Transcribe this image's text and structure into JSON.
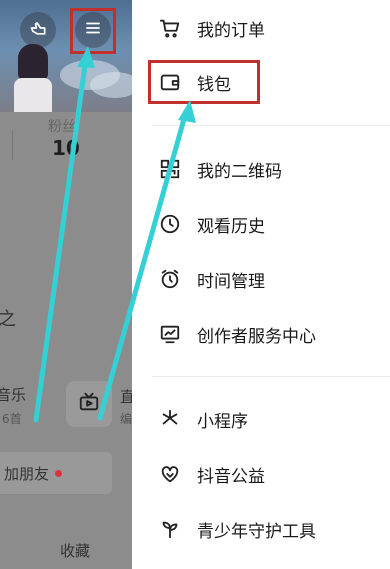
{
  "profile": {
    "fans_label": "粉丝",
    "fans_value": "10",
    "fragment_music": "音乐",
    "fragment_count": "6首",
    "fragment_char": "直",
    "fragment_side": "编",
    "fragment_left_char": "之",
    "add_friend_label": "加朋友",
    "favorites_label": "收藏"
  },
  "menu": {
    "items": [
      {
        "label": "我的订单",
        "icon": "cart-icon"
      },
      {
        "label": "钱包",
        "icon": "wallet-icon"
      },
      {
        "label": "我的二维码",
        "icon": "qrcode-icon"
      },
      {
        "label": "观看历史",
        "icon": "clock-icon"
      },
      {
        "label": "时间管理",
        "icon": "alarm-icon"
      },
      {
        "label": "创作者服务中心",
        "icon": "chart-icon"
      },
      {
        "label": "小程序",
        "icon": "asterisk-icon"
      },
      {
        "label": "抖音公益",
        "icon": "heart-icon"
      },
      {
        "label": "青少年守护工具",
        "icon": "sprout-icon"
      }
    ]
  },
  "colors": {
    "highlight": "#c0312e",
    "arrow": "#35d0d6",
    "notification_dot": "#e03040"
  }
}
